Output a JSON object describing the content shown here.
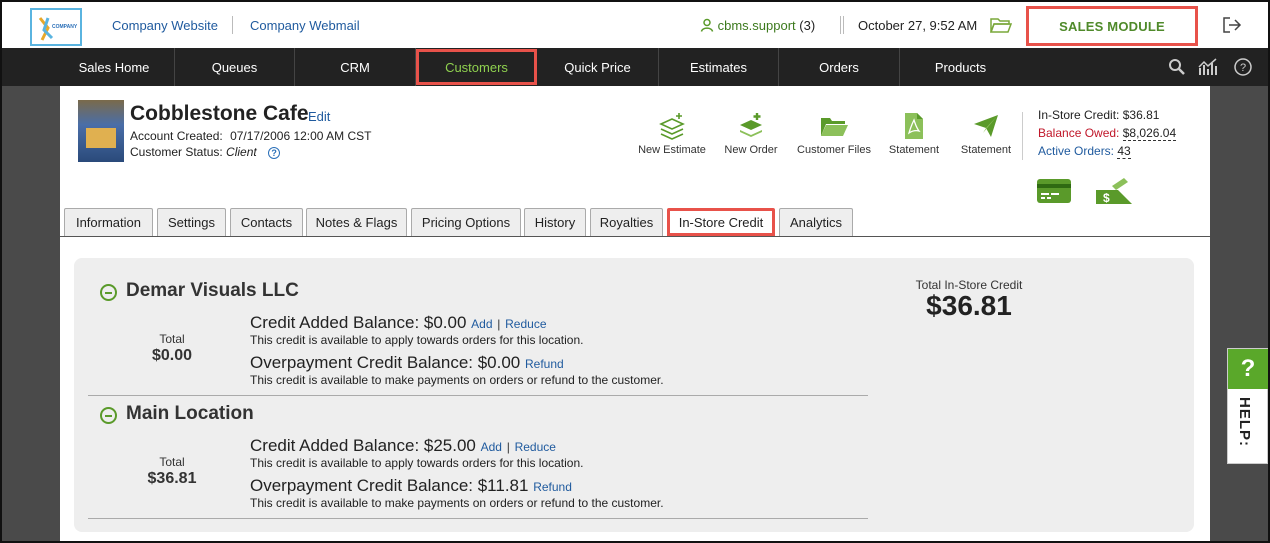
{
  "topbar": {
    "logo_text": "COMPANY",
    "company_website": "Company Website",
    "company_webmail": "Company Webmail",
    "user_name": "cbms.support",
    "user_count": "(3)",
    "datetime": "October 27, 9:52 AM",
    "module_button": "SALES MODULE"
  },
  "nav": {
    "items": [
      {
        "label": "Sales Home"
      },
      {
        "label": "Queues"
      },
      {
        "label": "CRM"
      },
      {
        "label": "Customers"
      },
      {
        "label": "Quick Price"
      },
      {
        "label": "Estimates"
      },
      {
        "label": "Orders"
      },
      {
        "label": "Products"
      }
    ],
    "active": "Customers"
  },
  "customer": {
    "name": "Cobblestone Cafe",
    "edit_label": "Edit",
    "account_created_label": "Account Created:",
    "account_created_value": "07/17/2006 12:00 AM CST",
    "status_label": "Customer Status:",
    "status_value": "Client"
  },
  "actions": {
    "new_estimate": "New Estimate",
    "new_order": "New Order",
    "customer_files": "Customer Files",
    "statement_pdf": "Statement",
    "statement_send": "Statement"
  },
  "summary": {
    "instore_label": "In-Store Credit:",
    "instore_value": "$36.81",
    "owed_label": "Balance Owed:",
    "owed_value": "$8,026.04",
    "orders_label": "Active Orders:",
    "orders_value": "43"
  },
  "tabs": {
    "information": "Information",
    "settings": "Settings",
    "contacts": "Contacts",
    "notes": "Notes & Flags",
    "pricing": "Pricing Options",
    "history": "History",
    "royalties": "Royalties",
    "instore": "In-Store Credit",
    "analytics": "Analytics"
  },
  "credit": {
    "total_label": "Total In-Store Credit",
    "total_value": "$36.81",
    "locations": [
      {
        "name": "Demar Visuals LLC",
        "total_label": "Total",
        "total_value": "$0.00",
        "added_label": "Credit Added Balance: $0.00",
        "add_link": "Add",
        "pipe": "|",
        "reduce_link": "Reduce",
        "added_desc": "This credit is available to apply towards orders for this location.",
        "overpay_label": "Overpayment Credit Balance: $0.00",
        "refund_link": "Refund",
        "overpay_desc": "This credit is available to make payments on orders or refund to the customer."
      },
      {
        "name": "Main Location",
        "total_label": "Total",
        "total_value": "$36.81",
        "added_label": "Credit Added Balance: $25.00",
        "add_link": "Add",
        "pipe": "|",
        "reduce_link": "Reduce",
        "added_desc": "This credit is available to apply towards orders for this location.",
        "overpay_label": "Overpayment Credit Balance: $11.81",
        "refund_link": "Refund",
        "overpay_desc": "This credit is available to make payments on orders or refund to the customer."
      }
    ]
  },
  "help": {
    "q": "?",
    "label": "HELP:"
  },
  "colors": {
    "accent_green": "#4f8a2a",
    "highlight_red": "#e8524a",
    "nav_bg": "#222222",
    "link_blue": "#1f5a9e",
    "owed_red": "#c0172a"
  }
}
